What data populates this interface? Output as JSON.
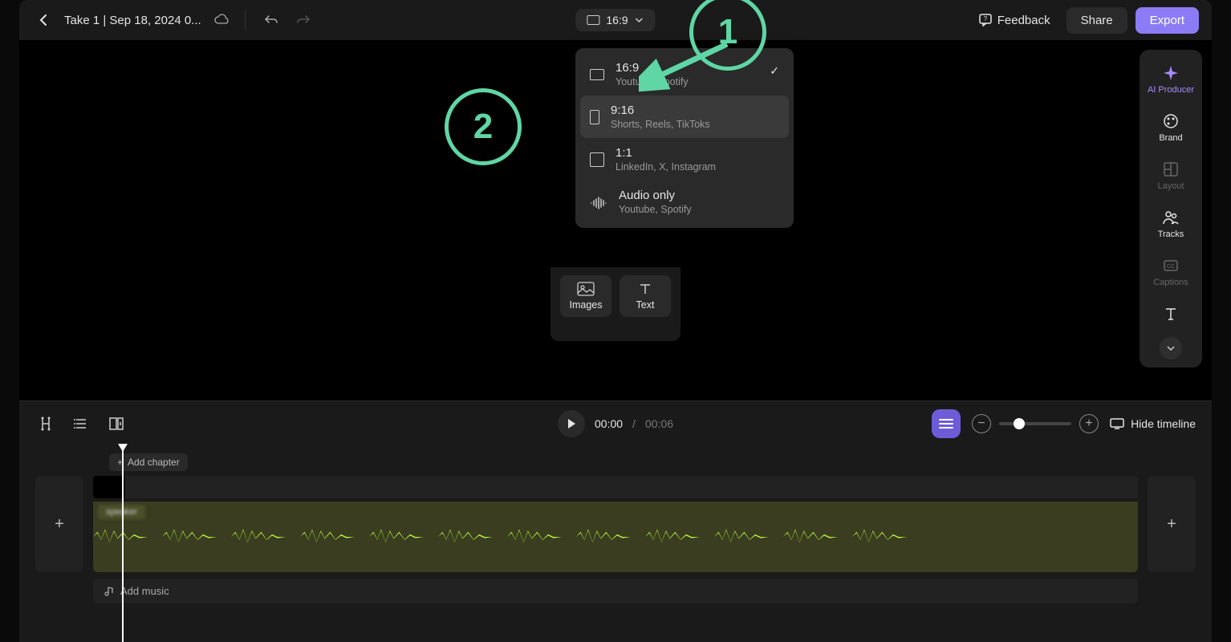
{
  "header": {
    "title": "Take 1 | Sep 18, 2024 0...",
    "aspect_label": "16:9",
    "feedback": "Feedback",
    "share": "Share",
    "export": "Export"
  },
  "dropdown": {
    "items": [
      {
        "label": "16:9",
        "sub": "Youtube, Spotify",
        "icon": "landscape",
        "selected": true
      },
      {
        "label": "9:16",
        "sub": "Shorts, Reels, TikToks",
        "icon": "portrait",
        "hover": true
      },
      {
        "label": "1:1",
        "sub": "LinkedIn, X, Instagram",
        "icon": "square"
      },
      {
        "label": "Audio only",
        "sub": "Youtube, Spotify",
        "icon": "audio"
      }
    ]
  },
  "add_tiles": {
    "images": "Images",
    "text": "Text"
  },
  "rail": {
    "ai": "AI Producer",
    "brand": "Brand",
    "layout": "Layout",
    "tracks": "Tracks",
    "captions": "Captions"
  },
  "toolbar": {
    "current_time": "00:00",
    "total_time": "00:06",
    "hide_timeline": "Hide timeline"
  },
  "timeline": {
    "add_chapter": "Add chapter",
    "add_music": "Add music"
  },
  "annotations": {
    "n1": "1",
    "n2": "2"
  },
  "colors": {
    "accent": "#8b7cf5",
    "anno": "#5fd6a5",
    "wave": "#b6f542"
  }
}
